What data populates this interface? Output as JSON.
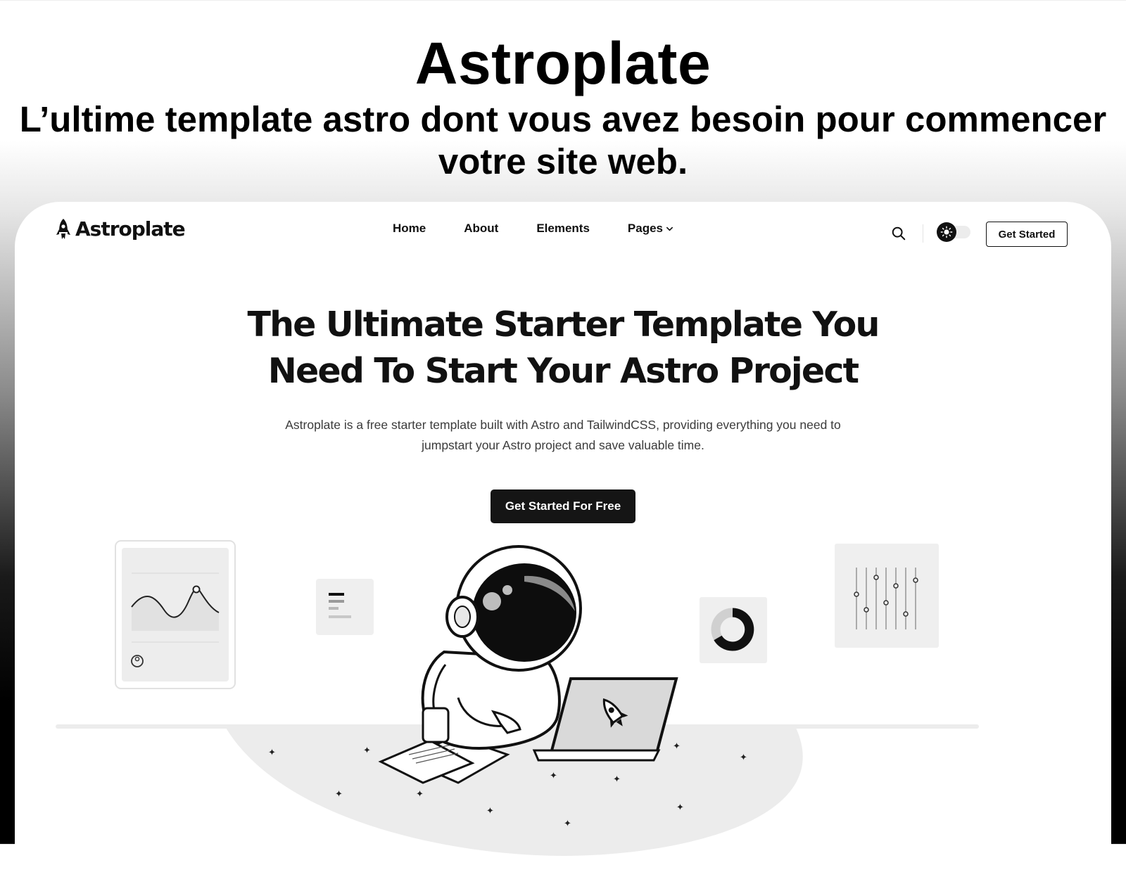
{
  "promo": {
    "title": "Astroplate",
    "subtitle": "L’ultime template astro dont vous avez besoin pour commencer votre site web."
  },
  "header": {
    "brand": "Astroplate",
    "brand_icon": "rocket-icon",
    "nav": [
      {
        "label": "Home"
      },
      {
        "label": "About"
      },
      {
        "label": "Elements"
      },
      {
        "label": "Pages",
        "icon": "chevron-down-icon"
      }
    ],
    "search_icon": "search-icon",
    "theme_icon": "sun-icon",
    "cta_label": "Get Started"
  },
  "hero": {
    "title": "The Ultimate Starter Template You Need To Start Your Astro Project",
    "description": "Astroplate is a free starter template built with Astro and TailwindCSS, providing everything you need to jumpstart your Astro project and save valuable time.",
    "cta_label": "Get Started For Free"
  },
  "colors": {
    "primary": "#151515",
    "text": "#111111",
    "muted_text": "#3b3b3b",
    "surface": "#ffffff",
    "card": "#f2f2f2"
  }
}
